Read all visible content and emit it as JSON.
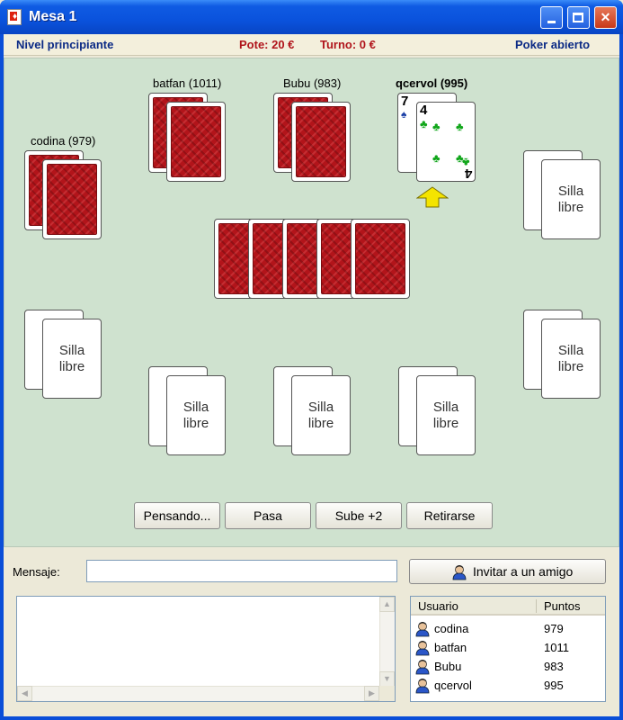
{
  "window": {
    "title": "Mesa 1"
  },
  "info": {
    "level": "Nivel principiante",
    "pot": "Pote: 20 €",
    "turn": "Turno: 0 €",
    "mode": "Poker abierto"
  },
  "players": {
    "codina": "codina (979)",
    "batfan": "batfan (1011)",
    "bubu": "Bubu (983)",
    "qcervol": "qcervol (995)"
  },
  "my_cards": [
    {
      "rank": "7",
      "suit": "spades"
    },
    {
      "rank": "4",
      "suit": "clubs"
    }
  ],
  "seat_label": "Silla\nlibre",
  "seat_line1": "Silla",
  "seat_line2": "libre",
  "actions": {
    "thinking": "Pensando...",
    "pass": "Pasa",
    "raise": "Sube +2",
    "fold": "Retirarse"
  },
  "message": {
    "label": "Mensaje:",
    "value": "",
    "invite": "Invitar a un amigo"
  },
  "users": {
    "headers": {
      "user": "Usuario",
      "points": "Puntos"
    },
    "rows": [
      {
        "name": "codina",
        "points": "979"
      },
      {
        "name": "batfan",
        "points": "1011"
      },
      {
        "name": "Bubu",
        "points": "983"
      },
      {
        "name": "qcervol",
        "points": "995"
      }
    ]
  },
  "colors": {
    "title_blue": "#0a52dc",
    "felt": "#cfe2cf",
    "card_back": "#b2141a",
    "info_blue": "#0b2a85",
    "info_red": "#b0141b"
  },
  "icons": {
    "user": "user-icon",
    "arrow": "turn-arrow-icon"
  }
}
